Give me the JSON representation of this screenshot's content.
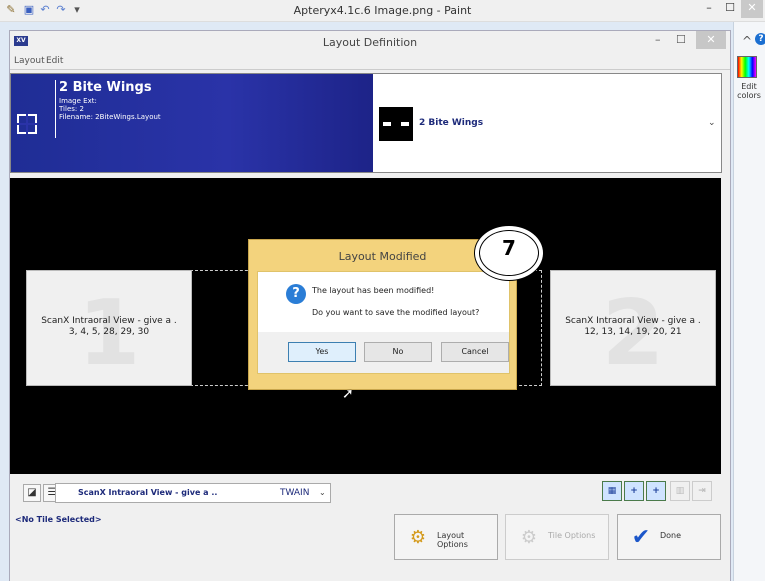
{
  "paint": {
    "title": "Apteryx4.1c.6 Image.png - Paint",
    "min": "–",
    "max": "☐",
    "close": "✕",
    "edit_colors_label": "Edit colors",
    "help": "?",
    "ribbon_collapse": "^"
  },
  "layout_window": {
    "app_icon_text": "XV",
    "title": "Layout Definition",
    "min": "–",
    "max": "☐",
    "close": "✕",
    "menu": [
      "Layout",
      "Edit"
    ]
  },
  "header": {
    "title": "2 Bite Wings",
    "image_ext": "Image Ext:",
    "tiles": "Tiles: 2",
    "filename": "Filename: 2BiteWings.Layout",
    "preview_label": "2 Bite Wings",
    "dropdown_arrow": "⌄"
  },
  "tiles": [
    {
      "number": "1",
      "line1": "ScanX Intraoral View - give a .",
      "line2": "3, 4, 5, 28, 29, 30"
    },
    {
      "number": "2",
      "line1": "ScanX Intraoral View - give a .",
      "line2": "12, 13, 14, 19, 20, 21"
    }
  ],
  "dialog": {
    "title": "Layout Modified",
    "icon": "?",
    "message1": "The layout has been modified!",
    "message2": "Do you want to save the modified layout?",
    "yes": "Yes",
    "no": "No",
    "cancel": "Cancel"
  },
  "callout": {
    "number": "7"
  },
  "bottom": {
    "source_text": "ScanX Intraoral View - give a ..",
    "source_type": "TWAIN",
    "source_arrow": "⌄",
    "layout_options": "Layout Options",
    "tile_options": "Tile Options",
    "done": "Done",
    "status": "<No Tile Selected>"
  },
  "colors": {
    "header_blue": "#2a33a8",
    "dialog_border": "#f3d37d",
    "done_check": "#1b56c9"
  }
}
